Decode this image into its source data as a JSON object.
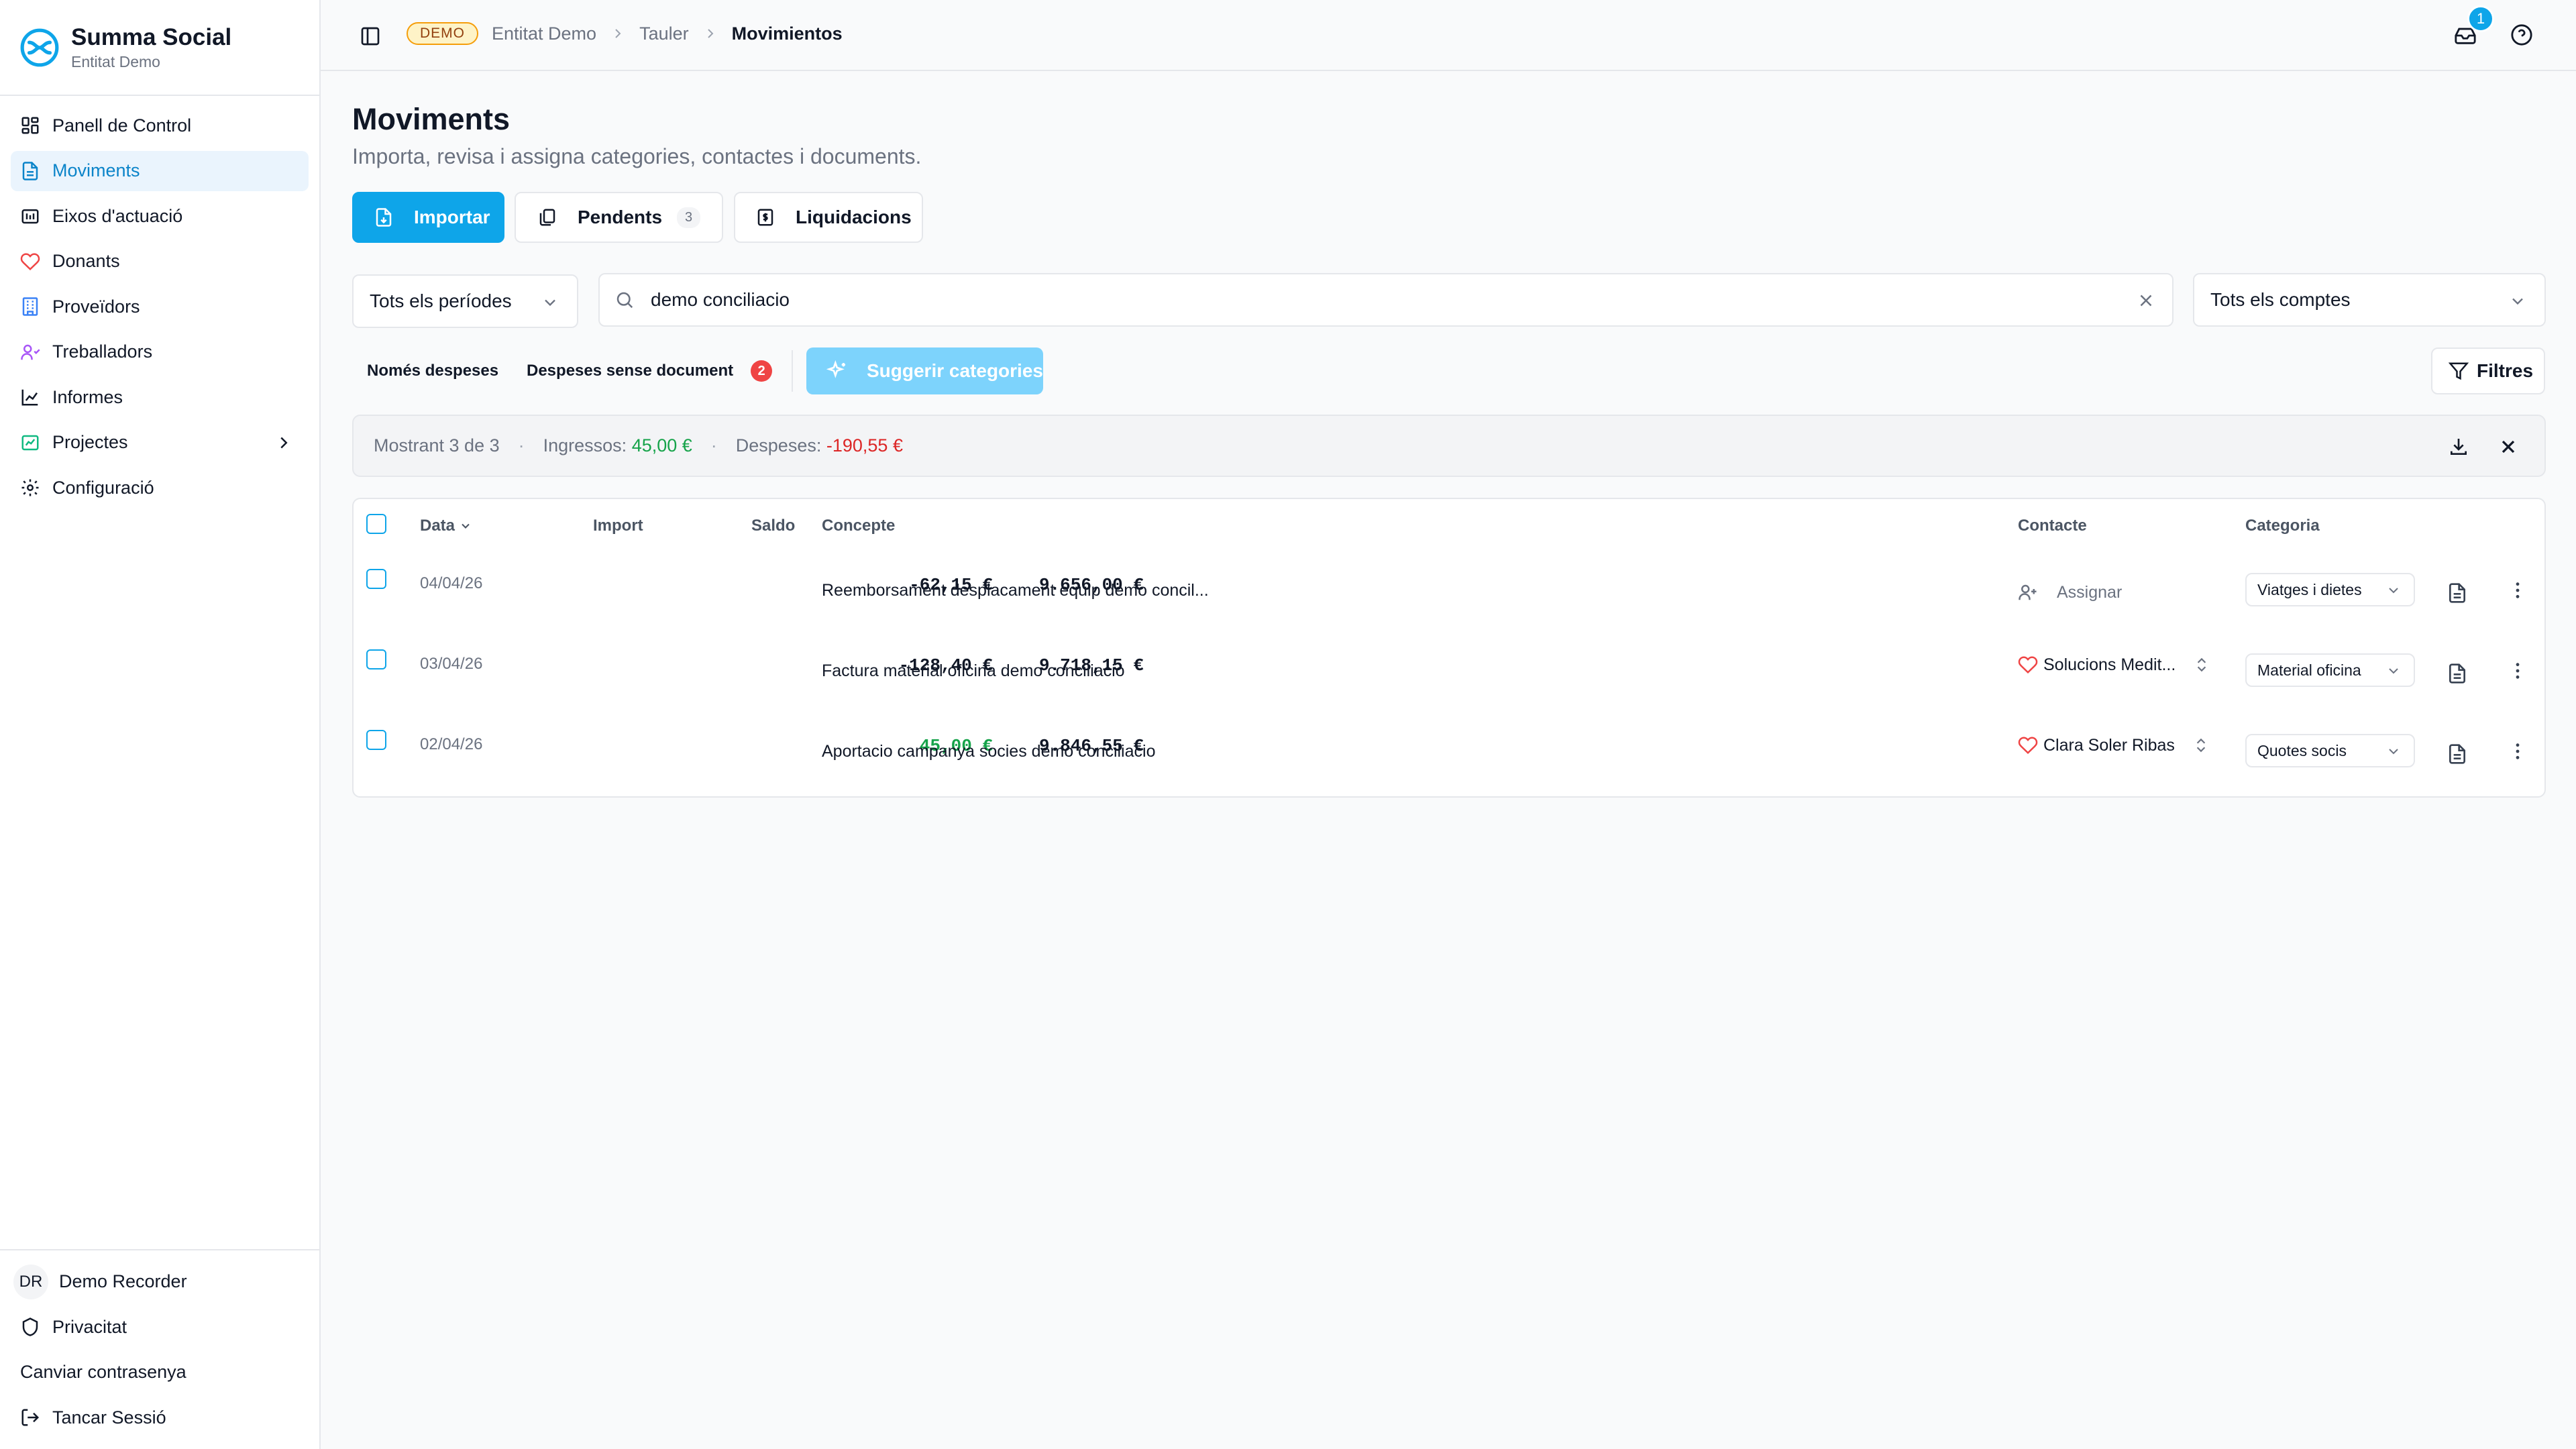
{
  "brand": {
    "title": "Summa Social",
    "subtitle": "Entitat Demo",
    "accent": "#0ea5e9"
  },
  "nav": [
    {
      "label": "Panell de Control",
      "icon": "dashboard-icon"
    },
    {
      "label": "Moviments",
      "icon": "document-icon",
      "active": true
    },
    {
      "label": "Eixos d'actuació",
      "icon": "folder-icon"
    },
    {
      "label": "Donants",
      "icon": "heart-icon"
    },
    {
      "label": "Proveïdors",
      "icon": "building-icon"
    },
    {
      "label": "Treballadors",
      "icon": "users-icon"
    },
    {
      "label": "Informes",
      "icon": "chart-icon"
    },
    {
      "label": "Projectes",
      "icon": "project-icon"
    },
    {
      "label": "Configuració",
      "icon": "gear-icon"
    }
  ],
  "user": {
    "initials": "DR",
    "name": "Demo Recorder"
  },
  "footer": {
    "privacy": "Privacitat",
    "change_password": "Canviar contrasenya",
    "logout": "Tancar Sessió"
  },
  "breadcrumb": {
    "badge": "DEMO",
    "entity": "Entitat Demo",
    "board": "Tauler",
    "current": "Movimientos"
  },
  "notifications": {
    "count": "1"
  },
  "page": {
    "title": "Moviments",
    "subtitle": "Importa, revisa i assigna categories, contactes i documents."
  },
  "actions": {
    "import": "Importar",
    "pending": "Pendents",
    "pending_count": "3",
    "settlements": "Liquidacions"
  },
  "filters": {
    "period": "Tots els períodes",
    "search_value": "demo conciliacio",
    "account": "Tots els comptes",
    "only_expenses": "Només despeses",
    "expenses_no_doc": "Despeses sense document",
    "expenses_no_doc_count": "2",
    "suggest": "Suggerir categories",
    "filters_btn": "Filtres"
  },
  "summary": {
    "showing": "Mostrant 3 de 3",
    "income_label": "Ingressos:",
    "income_value": "45,00 €",
    "expenses_label": "Despeses:",
    "expenses_value": "-190,55 €"
  },
  "table": {
    "headers": {
      "date": "Data",
      "amount": "Import",
      "balance": "Saldo",
      "concept": "Concepte",
      "contact": "Contacte",
      "category": "Categoria"
    },
    "rows": [
      {
        "date": "04/04/26",
        "amount": "-62,15 €",
        "balance": "9.656,00 €",
        "concept": "Reemborsament desplacament equip demo concil...",
        "contact": "Assignar",
        "category": "Viatges i dietes"
      },
      {
        "date": "03/04/26",
        "amount": "-128,40 €",
        "balance": "9.718,15 €",
        "concept": "Factura material oficina demo conciliacio",
        "contact": "Solucions Medit...",
        "category": "Material oficina"
      },
      {
        "date": "02/04/26",
        "amount": "45,00 €",
        "balance": "9.846,55 €",
        "concept": "Aportacio campanya socies demo conciliacio",
        "contact": "Clara Soler Ribas",
        "category": "Quotes socis"
      }
    ]
  }
}
